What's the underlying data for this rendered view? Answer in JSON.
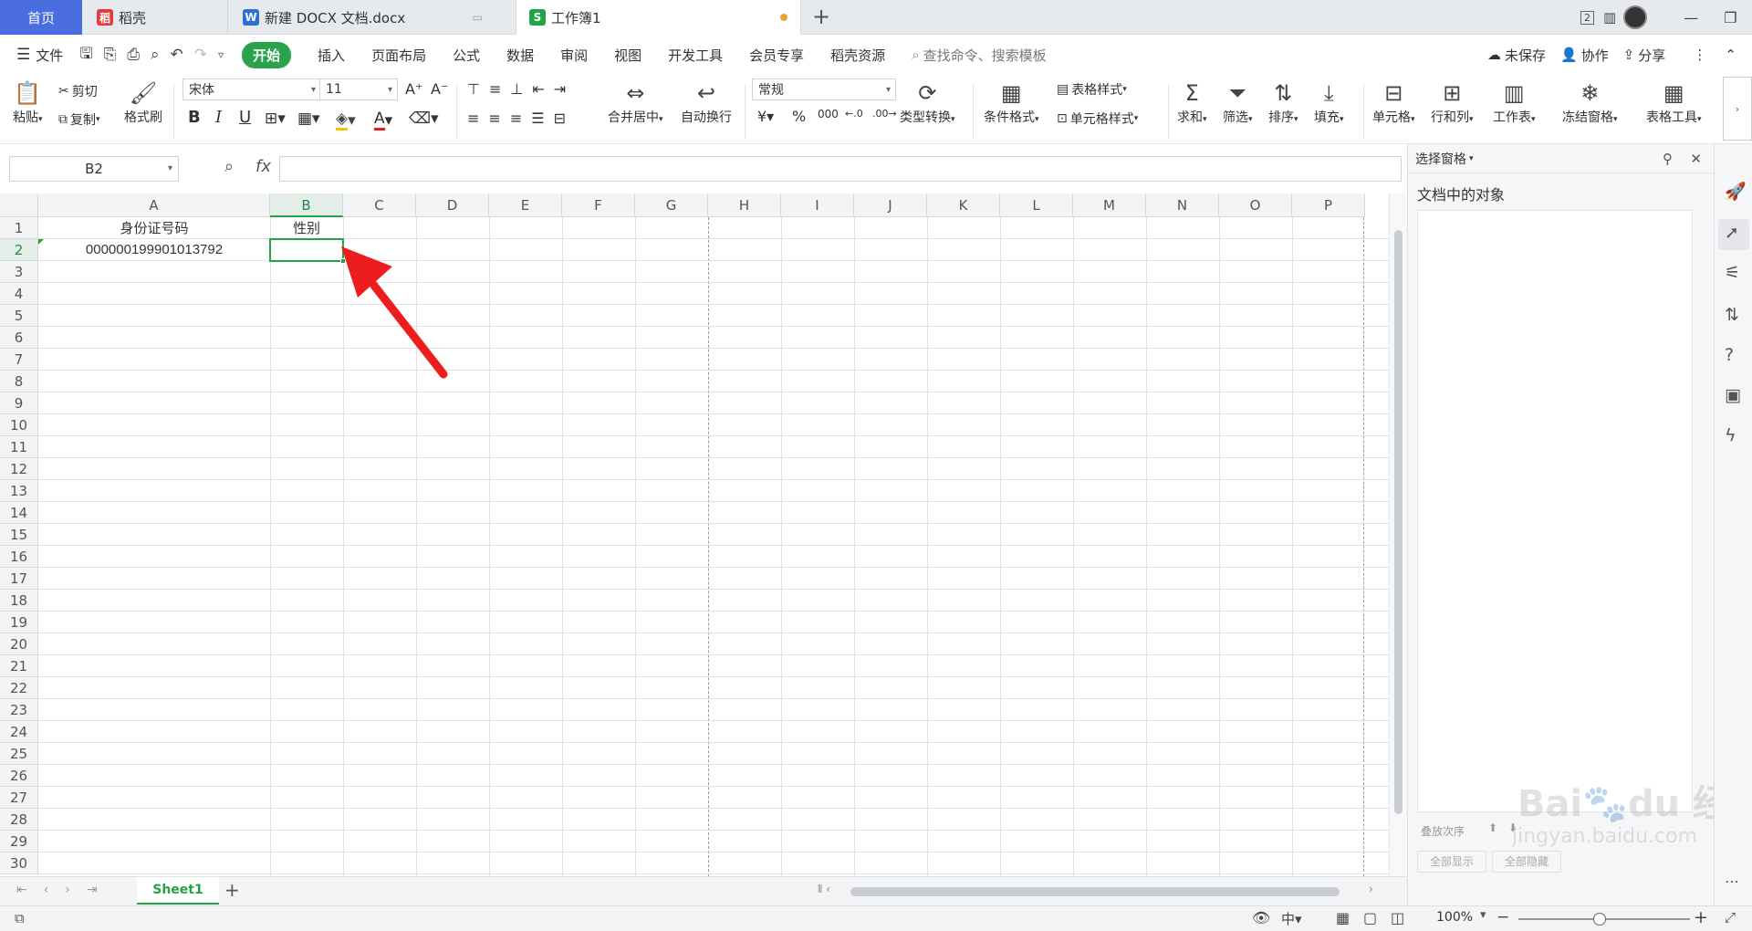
{
  "tabs": {
    "home": "首页",
    "daoke": "稻壳",
    "docx": "新建 DOCX 文档.docx",
    "workbook": "工作簿1",
    "badge": "2"
  },
  "menu": {
    "file": "文件",
    "items": [
      "开始",
      "插入",
      "页面布局",
      "公式",
      "数据",
      "审阅",
      "视图",
      "开发工具",
      "会员专享",
      "稻壳资源"
    ],
    "search_placeholder": "查找命令、搜索模板",
    "unsaved": "未保存",
    "collab": "协作",
    "share": "分享"
  },
  "ribbon": {
    "paste": "粘贴",
    "cut": "剪切",
    "copy": "复制",
    "format_painter": "格式刷",
    "font": "宋体",
    "font_size": "11",
    "bold": "B",
    "italic": "I",
    "underline": "U",
    "merge": "合并居中",
    "wrap": "自动换行",
    "number_format": "常规",
    "percent": "%",
    "thousands": "000",
    "type_convert": "类型转换",
    "cond_format": "条件格式",
    "table_style": "表格样式",
    "cell_style": "单元格样式",
    "sum": "求和",
    "filter": "筛选",
    "sort": "排序",
    "fill": "填充",
    "cell": "单元格",
    "rowcol": "行和列",
    "worksheet": "工作表",
    "freeze": "冻结窗格",
    "table_tools": "表格工具"
  },
  "formula": {
    "namebox": "B2",
    "fx": "fx",
    "value": ""
  },
  "grid": {
    "columns": [
      "A",
      "B",
      "C",
      "D",
      "E",
      "F",
      "G",
      "H",
      "I",
      "J",
      "K",
      "L",
      "M",
      "N",
      "O",
      "P"
    ],
    "rows": [
      "1",
      "2",
      "3",
      "4",
      "5",
      "6",
      "7",
      "8",
      "9",
      "10",
      "11",
      "12",
      "13",
      "14",
      "15",
      "16",
      "17",
      "18",
      "19",
      "20",
      "21",
      "22",
      "23",
      "24",
      "25",
      "26",
      "27",
      "28",
      "29",
      "30"
    ],
    "cells": {
      "A1": "身份证号码",
      "B1": "性别",
      "A2": "000000199901013792"
    },
    "selected_cell": "B2",
    "accent": "#21a346"
  },
  "sheets": {
    "active": "Sheet1"
  },
  "status": {
    "zoom": "100%"
  },
  "selection_pane": {
    "title": "选择窗格",
    "objects_label": "文档中的对象",
    "show_all": "全部显示",
    "hide_all": "全部隐藏",
    "reorder": "叠放次序"
  },
  "watermark": "Baidu经验 jingyan.baidu.com"
}
